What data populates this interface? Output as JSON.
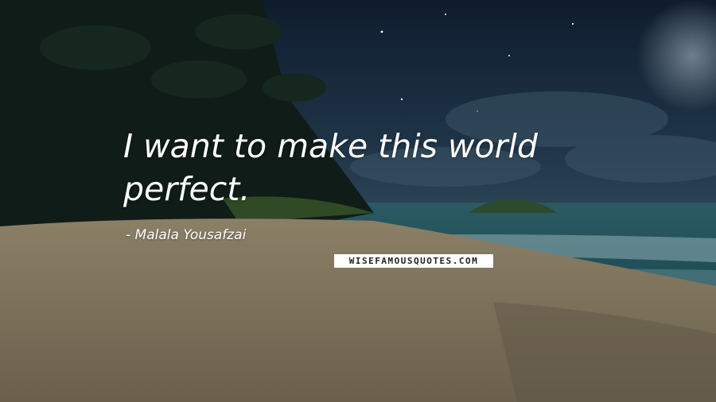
{
  "quote": {
    "line1": "I want to make this world",
    "line2": "perfect."
  },
  "author": {
    "name": "- Malala Yousafzai"
  },
  "watermark": {
    "text": "WISEFAMOUSQUOTES.COM"
  },
  "colors": {
    "sky": "#17293d",
    "sea": "#1d4a52",
    "sand": "#7a6f58",
    "text": "#ffffff"
  }
}
